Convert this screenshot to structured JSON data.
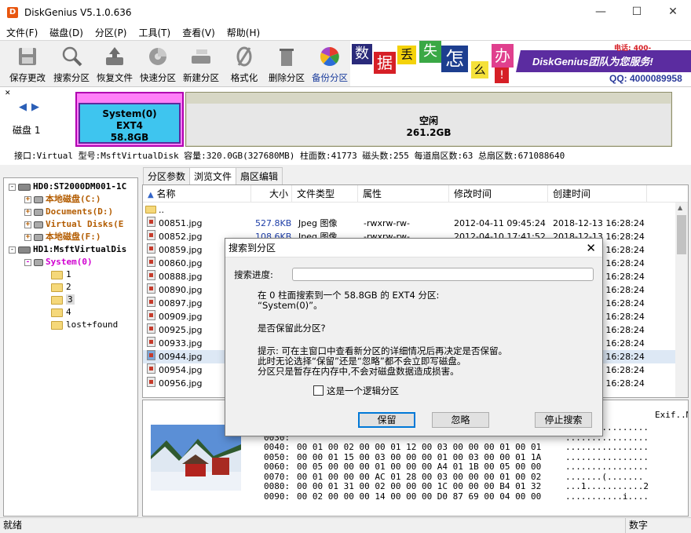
{
  "window": {
    "title": "DiskGenius V5.1.0.636"
  },
  "menu": [
    "文件(F)",
    "磁盘(D)",
    "分区(P)",
    "工具(T)",
    "查看(V)",
    "帮助(H)"
  ],
  "toolbar": {
    "buttons": [
      {
        "label": "保存更改",
        "icon": "save-icon"
      },
      {
        "label": "搜索分区",
        "icon": "search-icon"
      },
      {
        "label": "恢复文件",
        "icon": "recover-icon"
      },
      {
        "label": "快速分区",
        "icon": "quick-partition-icon"
      },
      {
        "label": "新建分区",
        "icon": "new-partition-icon"
      },
      {
        "label": "格式化",
        "icon": "format-icon"
      },
      {
        "label": "删除分区",
        "icon": "delete-icon"
      },
      {
        "label": "备份分区",
        "icon": "backup-icon"
      }
    ],
    "banner": {
      "chars": [
        "数",
        "据",
        "丢",
        "失",
        "怎",
        "么",
        "办",
        "!"
      ],
      "slogan": "DiskGenius团队为您服务!",
      "qq": "QQ: 4000089958",
      "tel_label": "电话: 400-"
    }
  },
  "disk_map": {
    "disk_label": "磁盘 1",
    "partitions": [
      {
        "name": "System(0)",
        "fs": "EXT4",
        "size": "58.8GB"
      },
      {
        "name": "空闲",
        "size": "261.2GB"
      }
    ],
    "info": "接口:Virtual  型号:MsftVirtualDisk  容量:320.0GB(327680MB)  柱面数:41773  磁头数:255  每道扇区数:63  总扇区数:671088640"
  },
  "tree": {
    "hd0": "HD0:ST2000DM001-1C",
    "hd0_items": [
      "本地磁盘(C:)",
      "Documents(D:)",
      "Virtual Disks(E",
      "本地磁盘(F:)"
    ],
    "hd1": "HD1:MsftVirtualDis",
    "hd1_part": "System(0)",
    "folders": [
      "1",
      "2",
      "3",
      "4",
      "lost+found"
    ]
  },
  "tabs": [
    "分区参数",
    "浏览文件",
    "扇区编辑"
  ],
  "file_list": {
    "columns": [
      "名称",
      "大小",
      "文件类型",
      "属性",
      "修改时间",
      "创建时间"
    ],
    "parent": "..",
    "rows": [
      {
        "name": "00851.jpg",
        "size": "527.8KB",
        "type": "Jpeg 图像",
        "attr": "-rwxrw-rw-",
        "mtime": "2012-04-11 09:45:24",
        "ctime": "2018-12-13 16:28:24"
      },
      {
        "name": "00852.jpg",
        "size": "108.6KB",
        "type": "Jpeg 图像",
        "attr": "-rwxrw-rw-",
        "mtime": "2012-04-10 17:41:52",
        "ctime": "2018-12-13 16:28:24"
      },
      {
        "name": "00859.jpg",
        "ctime": "2018-12-13 16:28:24"
      },
      {
        "name": "00860.jpg",
        "ctime": "2018-12-13 16:28:24"
      },
      {
        "name": "00888.jpg",
        "ctime": "2018-12-13 16:28:24"
      },
      {
        "name": "00890.jpg",
        "ctime": "2018-12-13 16:28:24"
      },
      {
        "name": "00897.jpg",
        "ctime": "2018-12-13 16:28:24"
      },
      {
        "name": "00909.jpg",
        "ctime": "2018-12-13 16:28:24"
      },
      {
        "name": "00925.jpg",
        "ctime": "2018-12-13 16:28:24"
      },
      {
        "name": "00933.jpg",
        "ctime": "2018-12-13 16:28:24"
      },
      {
        "name": "00944.jpg",
        "ctime": "2018-12-13 16:28:24",
        "selected": true
      },
      {
        "name": "00954.jpg",
        "ctime": "2018-12-13 16:28:24"
      },
      {
        "name": "00956.jpg",
        "ctime": "2018-12-13 16:28:24"
      }
    ]
  },
  "hex": {
    "top_right": "Exif..MM.*",
    "lines": [
      {
        "offset": "0020:",
        "bytes": "",
        "ascii": "................"
      },
      {
        "offset": "0030:",
        "bytes": "",
        "ascii": "................"
      },
      {
        "offset": "0040:",
        "bytes": "00 01 00 02 00 00 01 12 00 03 00 00 00 01 00 01",
        "ascii": "................"
      },
      {
        "offset": "0050:",
        "bytes": "00 00 01 15 00 03 00 00 00 01 00 03 00 00 01 1A",
        "ascii": "................"
      },
      {
        "offset": "0060:",
        "bytes": "00 05 00 00 00 01 00 00 00 A4 01 1B 00 05 00 00",
        "ascii": "................"
      },
      {
        "offset": "0070:",
        "bytes": "00 01 00 00 00 AC 01 28 00 03 00 00 00 01 00 02",
        "ascii": ".......(......."
      },
      {
        "offset": "0080:",
        "bytes": "00 00 01 31 00 02 00 00 00 1C 00 00 00 B4 01 32",
        "ascii": "...1...........2"
      },
      {
        "offset": "0090:",
        "bytes": "00 02 00 00 00 14 00 00 00 D0 87 69 00 04 00 00",
        "ascii": "...........i...."
      }
    ]
  },
  "status": {
    "left": "就绪",
    "right": "数字"
  },
  "dialog": {
    "title": "搜索到分区",
    "progress_label": "搜索进度:",
    "progress_value": 0,
    "msg_line1": "在 0 柱面搜索到一个 58.8GB 的 EXT4 分区:",
    "msg_line2": "“System(0)”。",
    "question": "是否保留此分区?",
    "hint1": "提示: 可在主窗口中查看新分区的详细情况后再决定是否保留。",
    "hint2": "此时无论选择“保留”还是“忽略”都不会立即写磁盘。",
    "hint3": "分区只是暂存在内存中,不会对磁盘数据造成损害。",
    "checkbox_label": "这是一个逻辑分区",
    "buttons": {
      "keep": "保留",
      "ignore": "忽略",
      "stop": "停止搜索"
    }
  }
}
